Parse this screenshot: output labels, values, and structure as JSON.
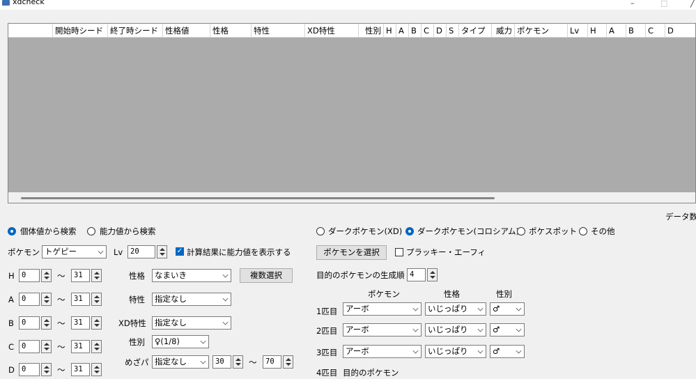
{
  "window": {
    "title": "xdcheck",
    "min_glyph": "–",
    "max_glyph": "□",
    "close_glyph": "╱"
  },
  "grid": {
    "columns": [
      "",
      "開始時シード",
      "終了時シード",
      "性格値",
      "性格",
      "特性",
      "XD特性",
      "性別",
      "H",
      "A",
      "B",
      "C",
      "D",
      "S",
      "タイプ",
      "威力",
      "ポケモン",
      "Lv",
      "H",
      "A",
      "B",
      "C",
      "D"
    ]
  },
  "data_count_label": "データ数:",
  "search_mode": {
    "options": [
      "個体値から検索",
      "能力値から検索"
    ],
    "selected": 0
  },
  "left": {
    "pokemon_label": "ポケモン",
    "pokemon_value": "トゲピー",
    "lv_label": "Lv",
    "lv_value": "20",
    "show_stats_label": "計算結果に能力値を表示する",
    "show_stats_checked": true,
    "iv_rows": [
      {
        "label": "H",
        "min": "0",
        "max": "31"
      },
      {
        "label": "A",
        "min": "0",
        "max": "31"
      },
      {
        "label": "B",
        "min": "0",
        "max": "31"
      },
      {
        "label": "C",
        "min": "0",
        "max": "31"
      },
      {
        "label": "D",
        "min": "0",
        "max": "31"
      }
    ],
    "tilde": "～",
    "nature_label": "性格",
    "nature_value": "なまいき",
    "multi_select_label": "複数選択",
    "ability_label": "特性",
    "ability_value": "指定なし",
    "xd_ability_label": "XD特性",
    "xd_ability_value": "指定なし",
    "gender_label": "性別",
    "gender_value": "♀(1/8)",
    "hp_label": "めざパ",
    "hp_value": "指定なし",
    "hp_power_min": "30",
    "hp_power_max": "70"
  },
  "right": {
    "mode_options": [
      "ダークポケモン(XD)",
      "ダークポケモン(コロシアム)",
      "ポケスポット",
      "その他"
    ],
    "mode_selected": 1,
    "select_pokemon_label": "ポケモンを選択",
    "plusle_label": "プラッキー・エーフィ",
    "plusle_checked": false,
    "order_label": "目的のポケモンの生成順",
    "order_value": "4",
    "col_headers": {
      "pokemon": "ポケモン",
      "nature": "性格",
      "gender": "性別"
    },
    "rows": [
      {
        "label": "1匹目",
        "pokemon": "アーボ",
        "nature": "いじっぱり",
        "gender": "♂"
      },
      {
        "label": "2匹目",
        "pokemon": "アーボ",
        "nature": "いじっぱり",
        "gender": "♂"
      },
      {
        "label": "3匹目",
        "pokemon": "アーボ",
        "nature": "いじっぱり",
        "gender": "♂"
      }
    ],
    "row4_label": "4匹目",
    "row4_value": "目的のポケモン"
  }
}
